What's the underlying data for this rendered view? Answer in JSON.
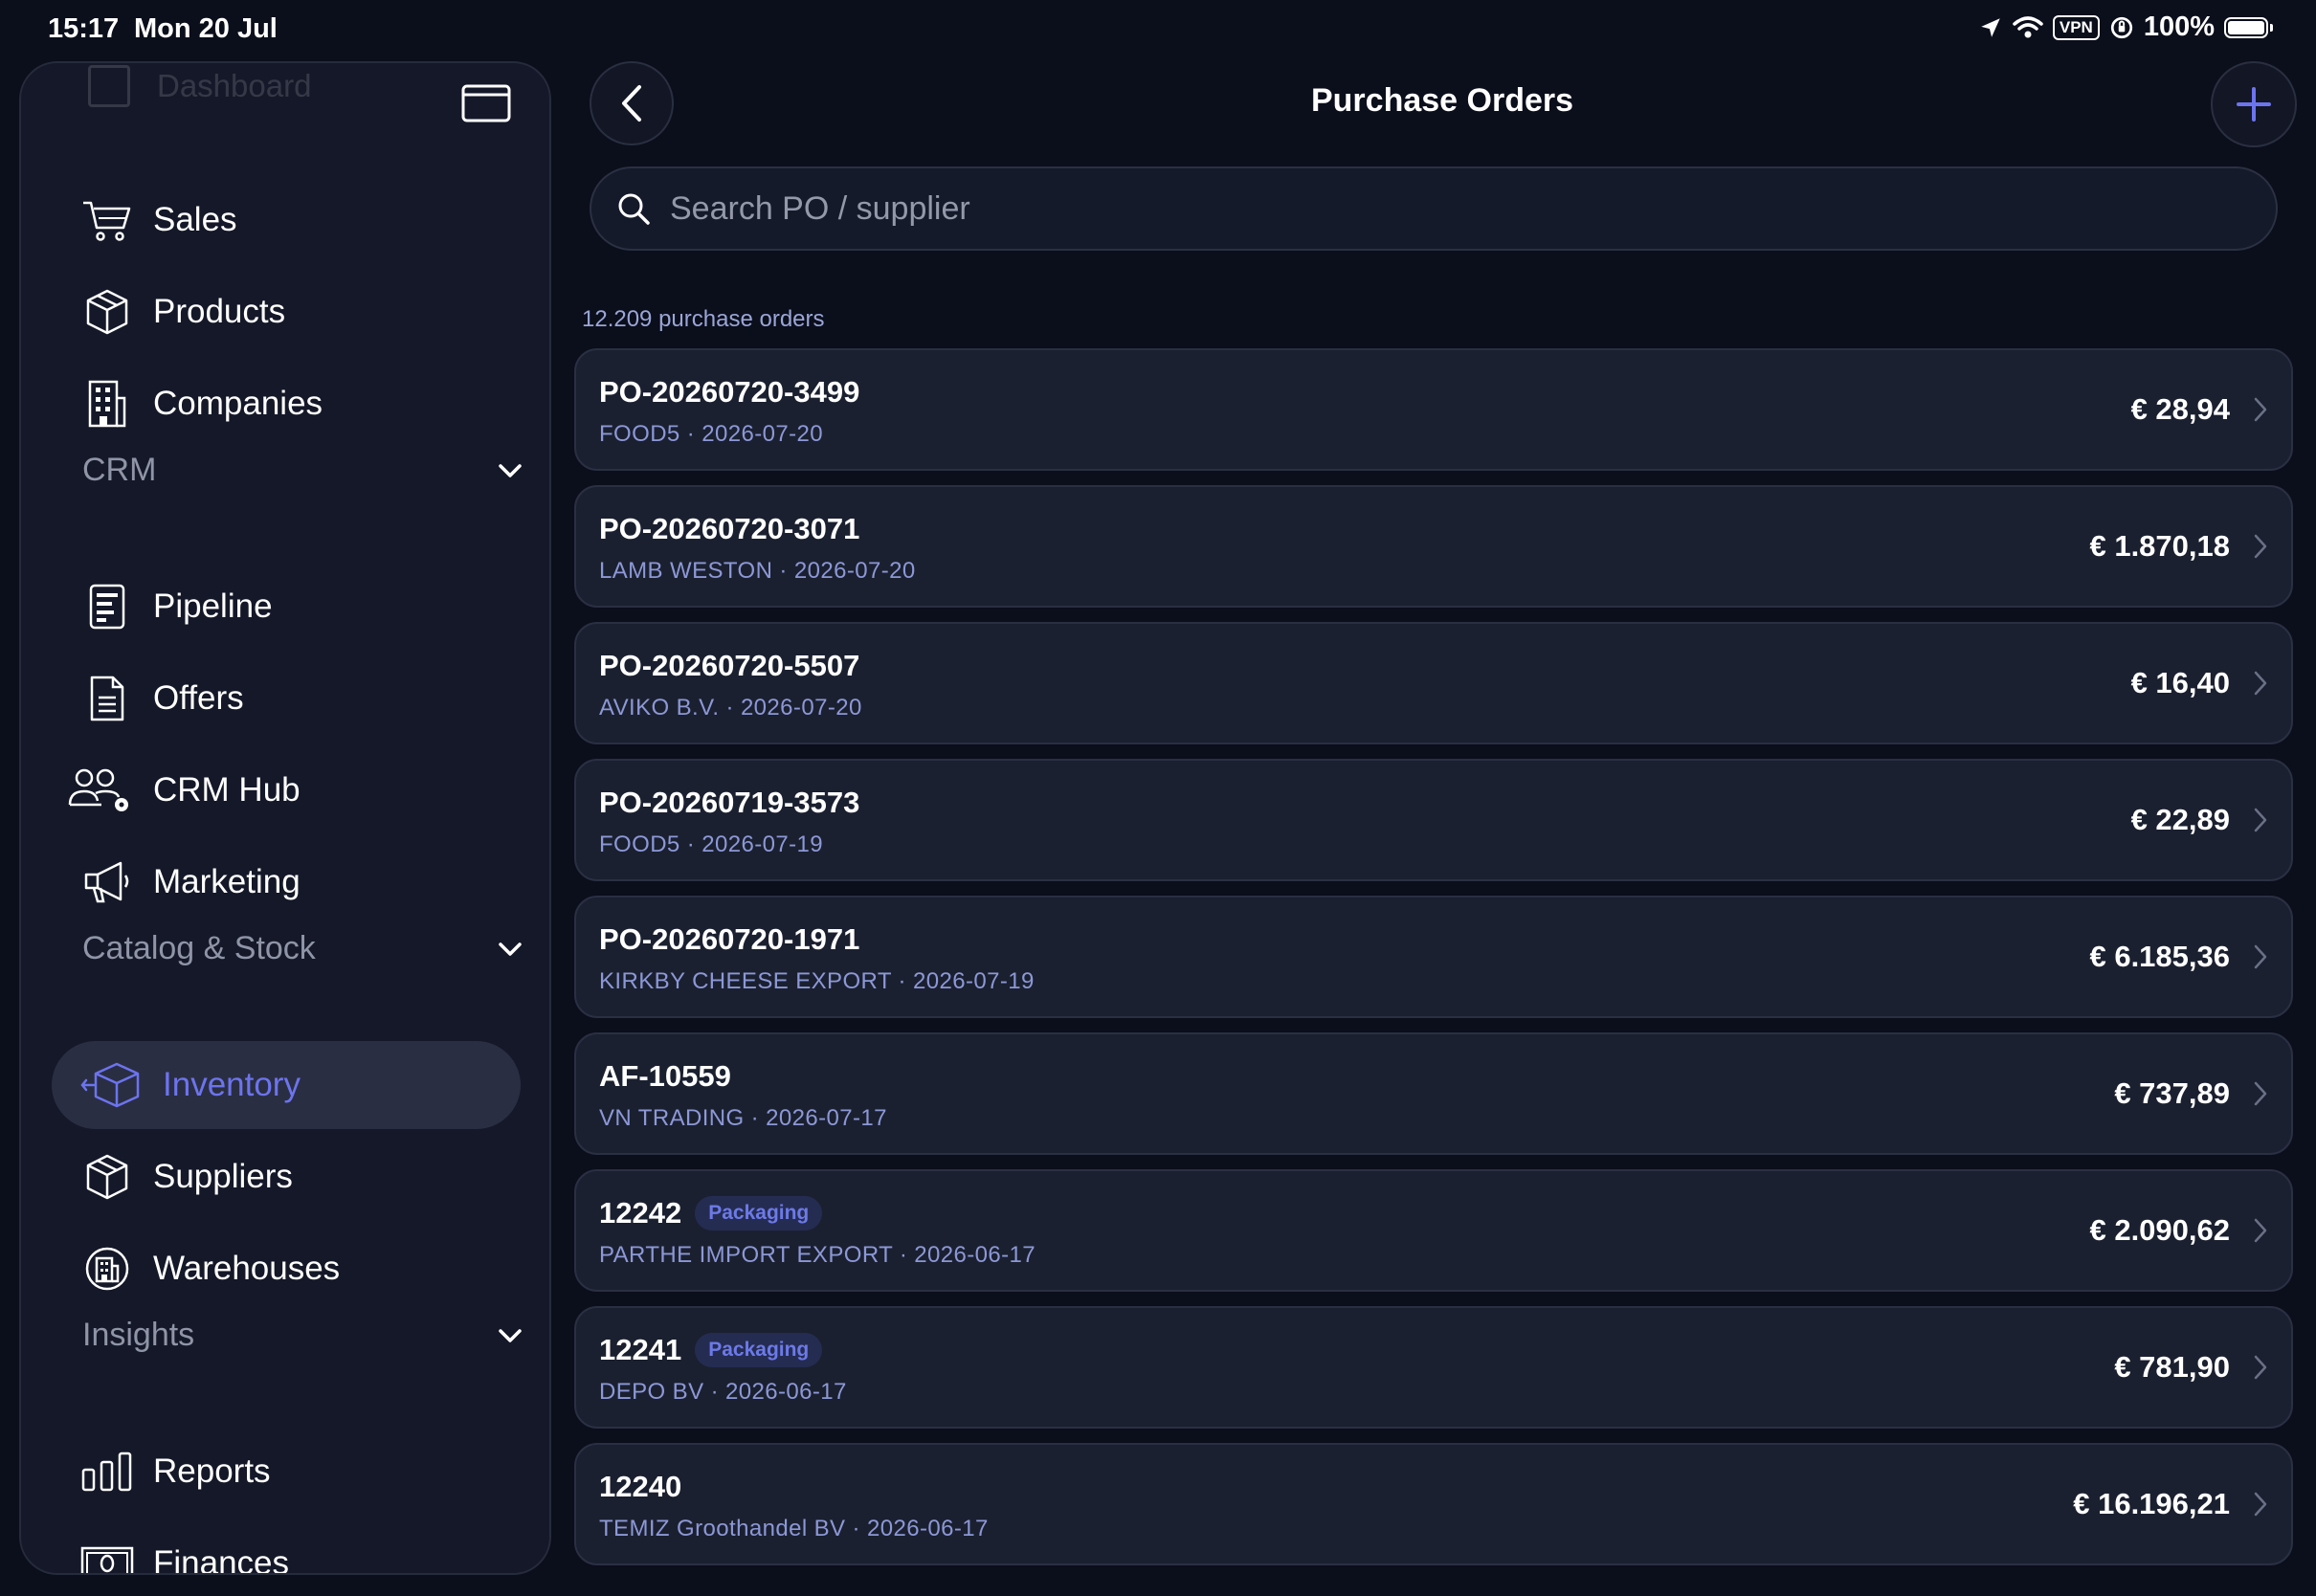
{
  "status": {
    "time": "15:17",
    "date": "Mon 20 Jul",
    "vpn": "VPN",
    "battery": "100%"
  },
  "sidebar": {
    "ghost_label": "Dashboard",
    "items_top": [
      {
        "label": "Sales",
        "icon": "cart-icon"
      },
      {
        "label": "Products",
        "icon": "box-icon"
      },
      {
        "label": "Companies",
        "icon": "building-icon"
      }
    ],
    "sections": [
      {
        "label": "CRM",
        "items": [
          {
            "label": "Pipeline",
            "icon": "pipeline-icon"
          },
          {
            "label": "Offers",
            "icon": "document-icon"
          },
          {
            "label": "CRM Hub",
            "icon": "people-gear-icon"
          },
          {
            "label": "Marketing",
            "icon": "megaphone-icon"
          }
        ]
      },
      {
        "label": "Catalog & Stock",
        "items": [
          {
            "label": "Inventory",
            "icon": "inventory-icon",
            "active": true
          },
          {
            "label": "Suppliers",
            "icon": "box-icon"
          },
          {
            "label": "Warehouses",
            "icon": "warehouse-icon"
          }
        ]
      },
      {
        "label": "Insights",
        "items": [
          {
            "label": "Reports",
            "icon": "bar-chart-icon"
          },
          {
            "label": "Finances",
            "icon": "banknote-icon"
          }
        ]
      }
    ]
  },
  "main": {
    "title": "Purchase Orders",
    "search_placeholder": "Search PO / supplier",
    "count_text": "12.209 purchase orders",
    "accent": "#6c74ee",
    "orders": [
      {
        "po": "PO-20260720-3499",
        "tag": "",
        "supplier": "FOOD5",
        "date": "2026-07-20",
        "amount": "€ 28,94"
      },
      {
        "po": "PO-20260720-3071",
        "tag": "",
        "supplier": "LAMB WESTON",
        "date": "2026-07-20",
        "amount": "€ 1.870,18"
      },
      {
        "po": "PO-20260720-5507",
        "tag": "",
        "supplier": "AVIKO B.V.",
        "date": "2026-07-20",
        "amount": "€ 16,40"
      },
      {
        "po": "PO-20260719-3573",
        "tag": "",
        "supplier": "FOOD5",
        "date": "2026-07-19",
        "amount": "€ 22,89"
      },
      {
        "po": "PO-20260720-1971",
        "tag": "",
        "supplier": "KIRKBY CHEESE EXPORT",
        "date": "2026-07-19",
        "amount": "€ 6.185,36"
      },
      {
        "po": "AF-10559",
        "tag": "",
        "supplier": "VN TRADING",
        "date": "2026-07-17",
        "amount": "€ 737,89"
      },
      {
        "po": "12242",
        "tag": "Packaging",
        "supplier": "PARTHE IMPORT EXPORT",
        "date": "2026-06-17",
        "amount": "€ 2.090,62"
      },
      {
        "po": "12241",
        "tag": "Packaging",
        "supplier": "DEPO BV",
        "date": "2026-06-17",
        "amount": "€ 781,90"
      },
      {
        "po": "12240",
        "tag": "",
        "supplier": "TEMIZ Groothandel BV",
        "date": "2026-06-17",
        "amount": "€ 16.196,21"
      }
    ]
  }
}
